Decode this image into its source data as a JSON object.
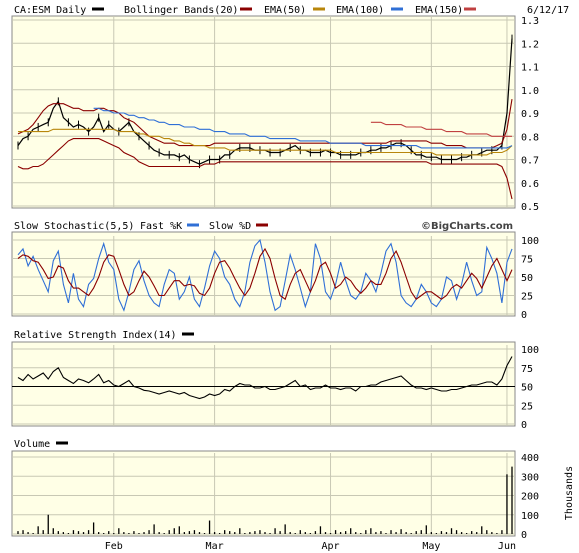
{
  "header": {
    "symbol": "CA:ESM Daily",
    "bollinger": "Bollinger Bands(20)",
    "ema50": "EMA(50)",
    "ema100": "EMA(100)",
    "ema150": "EMA(150)",
    "date": "6/12/17"
  },
  "colors": {
    "price": "#000000",
    "bollinger": "#8b0000",
    "ema50": "#b8860b",
    "ema100": "#2f6fd6",
    "ema150": "#c04040",
    "fast_k": "#2f6fd6",
    "slow_d": "#8b0000",
    "panel_bg": "#ffffe6",
    "grid": "#c8c8b4",
    "volume": "#000000"
  },
  "credit": "©BigCharts.com",
  "chart_data": [
    {
      "type": "line",
      "name": "price",
      "title": "CA:ESM Daily",
      "x_labels": [
        "Feb",
        "Mar",
        "Apr",
        "May",
        "Jun"
      ],
      "ylim": [
        0.5,
        1.3
      ],
      "y_ticks": [
        "1.3",
        "1.2",
        "1.1",
        "1.0",
        "0.9",
        "0.8",
        "0.7",
        "0.6",
        "0.5"
      ],
      "series": [
        {
          "name": "CA:ESM Daily",
          "values": [
            0.76,
            0.79,
            0.8,
            0.83,
            0.84,
            0.85,
            0.86,
            0.92,
            0.95,
            0.88,
            0.86,
            0.84,
            0.85,
            0.84,
            0.82,
            0.84,
            0.88,
            0.82,
            0.85,
            0.83,
            0.82,
            0.84,
            0.86,
            0.82,
            0.8,
            0.78,
            0.76,
            0.74,
            0.73,
            0.72,
            0.72,
            0.72,
            0.71,
            0.72,
            0.7,
            0.69,
            0.68,
            0.69,
            0.7,
            0.7,
            0.7,
            0.72,
            0.72,
            0.74,
            0.75,
            0.75,
            0.75,
            0.74,
            0.74,
            0.74,
            0.73,
            0.73,
            0.73,
            0.74,
            0.75,
            0.76,
            0.74,
            0.74,
            0.73,
            0.73,
            0.73,
            0.74,
            0.73,
            0.73,
            0.72,
            0.72,
            0.72,
            0.72,
            0.73,
            0.73,
            0.74,
            0.74,
            0.75,
            0.75,
            0.76,
            0.77,
            0.77,
            0.76,
            0.74,
            0.72,
            0.72,
            0.71,
            0.71,
            0.71,
            0.7,
            0.7,
            0.7,
            0.7,
            0.71,
            0.71,
            0.72,
            0.72,
            0.73,
            0.74,
            0.74,
            0.74,
            0.76,
            0.9,
            1.22
          ]
        },
        {
          "name": "Bollinger Bands(20)",
          "values": [
            0.67,
            0.66,
            0.66,
            0.67,
            0.67,
            0.68,
            0.7,
            0.72,
            0.74,
            0.76,
            0.78,
            0.79,
            0.79,
            0.79,
            0.79,
            0.79,
            0.79,
            0.78,
            0.77,
            0.76,
            0.75,
            0.73,
            0.72,
            0.71,
            0.69,
            0.68,
            0.67,
            0.67,
            0.67,
            0.67,
            0.67,
            0.67,
            0.67,
            0.67,
            0.67,
            0.67,
            0.67,
            0.68,
            0.68,
            0.68,
            0.69,
            0.69,
            0.69,
            0.69,
            0.69,
            0.69,
            0.69,
            0.69,
            0.69,
            0.69,
            0.69,
            0.69,
            0.69,
            0.69,
            0.69,
            0.69,
            0.69,
            0.69,
            0.69,
            0.69,
            0.69,
            0.69,
            0.69,
            0.69,
            0.69,
            0.69,
            0.69,
            0.69,
            0.69,
            0.69,
            0.69,
            0.69,
            0.69,
            0.69,
            0.69,
            0.69,
            0.69,
            0.69,
            0.69,
            0.69,
            0.69,
            0.69,
            0.68,
            0.68,
            0.68,
            0.68,
            0.68,
            0.68,
            0.68,
            0.68,
            0.68,
            0.68,
            0.68,
            0.68,
            0.68,
            0.68,
            0.67,
            0.62,
            0.53
          ]
        },
        {
          "name": "Bollinger Bands(20) upper",
          "values": [
            0.81,
            0.82,
            0.83,
            0.85,
            0.88,
            0.91,
            0.93,
            0.94,
            0.94,
            0.94,
            0.93,
            0.92,
            0.92,
            0.91,
            0.91,
            0.91,
            0.92,
            0.92,
            0.91,
            0.91,
            0.9,
            0.88,
            0.87,
            0.86,
            0.84,
            0.82,
            0.8,
            0.79,
            0.78,
            0.77,
            0.77,
            0.77,
            0.76,
            0.76,
            0.76,
            0.76,
            0.76,
            0.76,
            0.76,
            0.77,
            0.77,
            0.77,
            0.77,
            0.77,
            0.77,
            0.77,
            0.77,
            0.77,
            0.77,
            0.77,
            0.77,
            0.77,
            0.77,
            0.77,
            0.77,
            0.77,
            0.77,
            0.77,
            0.77,
            0.77,
            0.77,
            0.77,
            0.77,
            0.77,
            0.77,
            0.77,
            0.77,
            0.77,
            0.77,
            0.77,
            0.77,
            0.77,
            0.77,
            0.77,
            0.78,
            0.78,
            0.78,
            0.78,
            0.78,
            0.78,
            0.78,
            0.78,
            0.77,
            0.77,
            0.77,
            0.76,
            0.76,
            0.76,
            0.76,
            0.75,
            0.75,
            0.75,
            0.75,
            0.75,
            0.75,
            0.76,
            0.77,
            0.83,
            0.96
          ]
        },
        {
          "name": "EMA(50)",
          "values": [
            0.82,
            0.82,
            0.82,
            0.82,
            0.82,
            0.82,
            0.82,
            0.83,
            0.83,
            0.83,
            0.83,
            0.83,
            0.83,
            0.83,
            0.83,
            0.83,
            0.83,
            0.83,
            0.83,
            0.83,
            0.82,
            0.82,
            0.82,
            0.82,
            0.81,
            0.81,
            0.8,
            0.8,
            0.8,
            0.79,
            0.79,
            0.78,
            0.78,
            0.77,
            0.77,
            0.76,
            0.76,
            0.76,
            0.75,
            0.75,
            0.75,
            0.75,
            0.74,
            0.74,
            0.74,
            0.74,
            0.74,
            0.74,
            0.74,
            0.74,
            0.74,
            0.74,
            0.74,
            0.74,
            0.74,
            0.74,
            0.74,
            0.74,
            0.74,
            0.74,
            0.74,
            0.74,
            0.74,
            0.73,
            0.73,
            0.73,
            0.73,
            0.73,
            0.73,
            0.73,
            0.73,
            0.73,
            0.73,
            0.73,
            0.73,
            0.73,
            0.73,
            0.73,
            0.73,
            0.73,
            0.73,
            0.73,
            0.73,
            0.72,
            0.72,
            0.72,
            0.72,
            0.72,
            0.72,
            0.72,
            0.72,
            0.72,
            0.72,
            0.72,
            0.73,
            0.73,
            0.73,
            0.74,
            0.76
          ]
        },
        {
          "name": "EMA(100)",
          "values": [
            null,
            null,
            null,
            null,
            null,
            null,
            null,
            null,
            null,
            null,
            null,
            null,
            null,
            null,
            null,
            0.92,
            0.92,
            0.91,
            0.91,
            0.9,
            0.9,
            0.9,
            0.89,
            0.89,
            0.88,
            0.88,
            0.87,
            0.87,
            0.86,
            0.86,
            0.85,
            0.85,
            0.85,
            0.84,
            0.84,
            0.84,
            0.83,
            0.83,
            0.83,
            0.82,
            0.82,
            0.82,
            0.81,
            0.81,
            0.81,
            0.81,
            0.8,
            0.8,
            0.8,
            0.8,
            0.79,
            0.79,
            0.79,
            0.79,
            0.79,
            0.79,
            0.78,
            0.78,
            0.78,
            0.78,
            0.78,
            0.78,
            0.77,
            0.77,
            0.77,
            0.77,
            0.77,
            0.77,
            0.77,
            0.76,
            0.76,
            0.76,
            0.76,
            0.76,
            0.76,
            0.76,
            0.76,
            0.76,
            0.76,
            0.76,
            0.75,
            0.75,
            0.75,
            0.75,
            0.75,
            0.75,
            0.75,
            0.75,
            0.75,
            0.75,
            0.75,
            0.75,
            0.75,
            0.75,
            0.75,
            0.75,
            0.75,
            0.75,
            0.76
          ]
        },
        {
          "name": "EMA(150)",
          "values": [
            null,
            null,
            null,
            null,
            null,
            null,
            null,
            null,
            null,
            null,
            null,
            null,
            null,
            null,
            null,
            null,
            null,
            null,
            null,
            null,
            null,
            null,
            null,
            null,
            null,
            null,
            null,
            null,
            null,
            null,
            null,
            null,
            null,
            null,
            null,
            null,
            null,
            null,
            null,
            null,
            null,
            null,
            null,
            null,
            null,
            null,
            null,
            null,
            null,
            null,
            null,
            null,
            null,
            null,
            null,
            null,
            null,
            null,
            null,
            null,
            null,
            null,
            null,
            null,
            null,
            null,
            null,
            null,
            null,
            null,
            0.86,
            0.86,
            0.86,
            0.85,
            0.85,
            0.85,
            0.85,
            0.84,
            0.84,
            0.84,
            0.84,
            0.83,
            0.83,
            0.83,
            0.83,
            0.82,
            0.82,
            0.82,
            0.82,
            0.81,
            0.81,
            0.81,
            0.81,
            0.81,
            0.8,
            0.8,
            0.8,
            0.8,
            0.8
          ]
        }
      ]
    },
    {
      "type": "line",
      "name": "stochastic",
      "title": "Slow Stochastic(5,5)",
      "legend": [
        "Fast %K",
        "Slow %D"
      ],
      "ylim": [
        0,
        100
      ],
      "y_ticks": [
        "100",
        "75",
        "50",
        "25",
        "0"
      ],
      "series": [
        {
          "name": "Fast %K",
          "values": [
            80,
            88,
            65,
            78,
            60,
            45,
            30,
            72,
            85,
            40,
            15,
            55,
            20,
            10,
            40,
            48,
            75,
            95,
            70,
            60,
            20,
            5,
            30,
            60,
            72,
            45,
            25,
            15,
            10,
            40,
            60,
            55,
            20,
            30,
            50,
            20,
            10,
            35,
            65,
            85,
            75,
            50,
            40,
            20,
            10,
            30,
            70,
            92,
            100,
            70,
            30,
            5,
            10,
            45,
            80,
            60,
            35,
            10,
            30,
            95,
            75,
            30,
            20,
            40,
            70,
            45,
            25,
            20,
            30,
            55,
            45,
            30,
            55,
            85,
            95,
            70,
            25,
            15,
            10,
            20,
            40,
            30,
            15,
            10,
            20,
            50,
            45,
            20,
            40,
            70,
            45,
            25,
            30,
            90,
            75,
            55,
            15,
            70,
            88
          ]
        },
        {
          "name": "Slow %D",
          "values": [
            75,
            80,
            78,
            72,
            70,
            60,
            48,
            50,
            65,
            62,
            45,
            35,
            35,
            30,
            25,
            35,
            50,
            70,
            80,
            78,
            60,
            40,
            25,
            30,
            45,
            58,
            50,
            38,
            25,
            25,
            35,
            45,
            45,
            38,
            40,
            38,
            28,
            25,
            35,
            55,
            70,
            72,
            62,
            48,
            35,
            25,
            35,
            55,
            78,
            88,
            75,
            48,
            25,
            20,
            40,
            55,
            60,
            45,
            30,
            45,
            65,
            70,
            55,
            35,
            40,
            50,
            45,
            35,
            28,
            35,
            45,
            40,
            40,
            55,
            75,
            85,
            70,
            50,
            30,
            20,
            25,
            30,
            30,
            25,
            20,
            25,
            35,
            40,
            35,
            45,
            55,
            48,
            35,
            50,
            65,
            75,
            60,
            45,
            60
          ]
        }
      ]
    },
    {
      "type": "line",
      "name": "rsi",
      "title": "Relative Strength Index(14)",
      "ylim": [
        0,
        100
      ],
      "y_ticks": [
        "100",
        "75",
        "50",
        "25",
        "0"
      ],
      "series": [
        {
          "name": "Relative Strength Index(14)",
          "values": [
            62,
            58,
            66,
            60,
            64,
            68,
            60,
            70,
            75,
            62,
            58,
            54,
            60,
            58,
            55,
            60,
            66,
            55,
            58,
            52,
            50,
            54,
            58,
            50,
            48,
            45,
            44,
            42,
            40,
            42,
            44,
            42,
            40,
            42,
            38,
            36,
            34,
            36,
            40,
            38,
            40,
            46,
            44,
            50,
            54,
            52,
            52,
            48,
            48,
            50,
            46,
            46,
            48,
            50,
            54,
            58,
            50,
            52,
            46,
            48,
            48,
            52,
            48,
            48,
            46,
            48,
            48,
            44,
            50,
            50,
            52,
            52,
            56,
            58,
            60,
            62,
            64,
            58,
            52,
            48,
            48,
            46,
            48,
            46,
            44,
            44,
            46,
            46,
            48,
            50,
            52,
            52,
            54,
            56,
            56,
            52,
            60,
            78,
            90
          ]
        }
      ]
    },
    {
      "type": "bar",
      "name": "volume",
      "title": "Volume",
      "ylabel": "Thousands",
      "ylim": [
        0,
        400
      ],
      "y_ticks": [
        "400",
        "300",
        "200",
        "100",
        "0"
      ],
      "values": [
        15,
        20,
        10,
        5,
        40,
        20,
        100,
        30,
        15,
        10,
        5,
        20,
        15,
        10,
        20,
        60,
        10,
        5,
        15,
        5,
        30,
        10,
        5,
        15,
        5,
        10,
        20,
        50,
        10,
        5,
        20,
        30,
        40,
        10,
        15,
        20,
        10,
        5,
        70,
        10,
        5,
        20,
        15,
        10,
        30,
        5,
        10,
        15,
        20,
        10,
        5,
        30,
        15,
        50,
        10,
        5,
        20,
        10,
        5,
        15,
        40,
        10,
        5,
        20,
        10,
        15,
        30,
        10,
        5,
        20,
        30,
        10,
        15,
        5,
        20,
        10,
        25,
        10,
        5,
        15,
        20,
        45,
        10,
        5,
        15,
        10,
        30,
        20,
        10,
        5,
        15,
        10,
        40,
        20,
        10,
        5,
        20,
        310,
        350
      ]
    }
  ]
}
